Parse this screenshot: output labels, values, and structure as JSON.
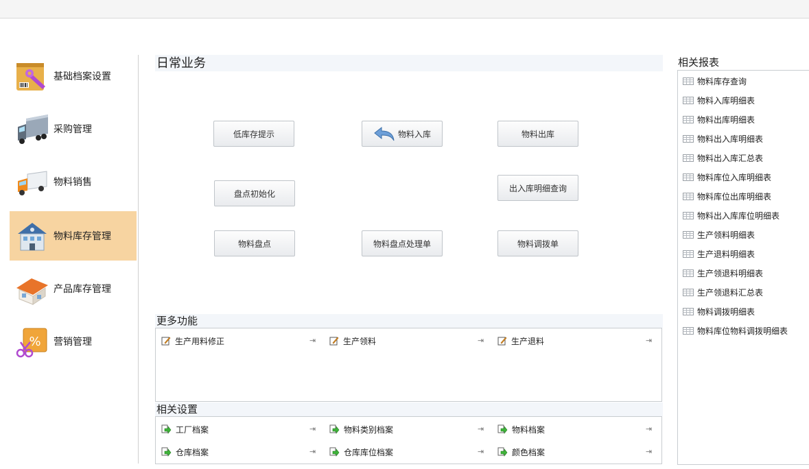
{
  "sidebar": {
    "items": [
      {
        "label": "基础档案设置",
        "icon": "archive-settings-icon"
      },
      {
        "label": "采购管理",
        "icon": "truck-icon"
      },
      {
        "label": "物料销售",
        "icon": "delivery-truck-icon"
      },
      {
        "label": "物料库存管理",
        "icon": "warehouse-building-icon"
      },
      {
        "label": "产品库存管理",
        "icon": "house-icon"
      },
      {
        "label": "营销管理",
        "icon": "discount-tag-icon"
      }
    ],
    "active_color": "#f7d4a1"
  },
  "daily": {
    "title": "日常业务",
    "buttons": [
      "低库存提示",
      "物料入库",
      "物料出库",
      "盘点初始化",
      "出入库明细查询",
      "物料盘点",
      "物料盘点处理单",
      "物料调拨单"
    ]
  },
  "more": {
    "title": "更多功能",
    "items": [
      "生产用料修正",
      "生产领料",
      "生产退料"
    ]
  },
  "settings": {
    "title": "相关设置",
    "items": [
      "工厂档案",
      "物料类别档案",
      "物料档案",
      "仓库档案",
      "仓库库位档案",
      "颜色档案"
    ]
  },
  "pin_glyph": "⇥",
  "reports": {
    "title": "相关报表",
    "items": [
      "物料库存查询",
      "物料入库明细表",
      "物料出库明细表",
      "物料出入库明细表",
      "物料出入库汇总表",
      "物料库位入库明细表",
      "物料库位出库明细表",
      "物料出入库库位明细表",
      "生产领料明细表",
      "生产退料明细表",
      "生产领退料明细表",
      "生产领退料汇总表",
      "物料调拨明细表",
      "物料库位物料调拨明细表"
    ]
  }
}
